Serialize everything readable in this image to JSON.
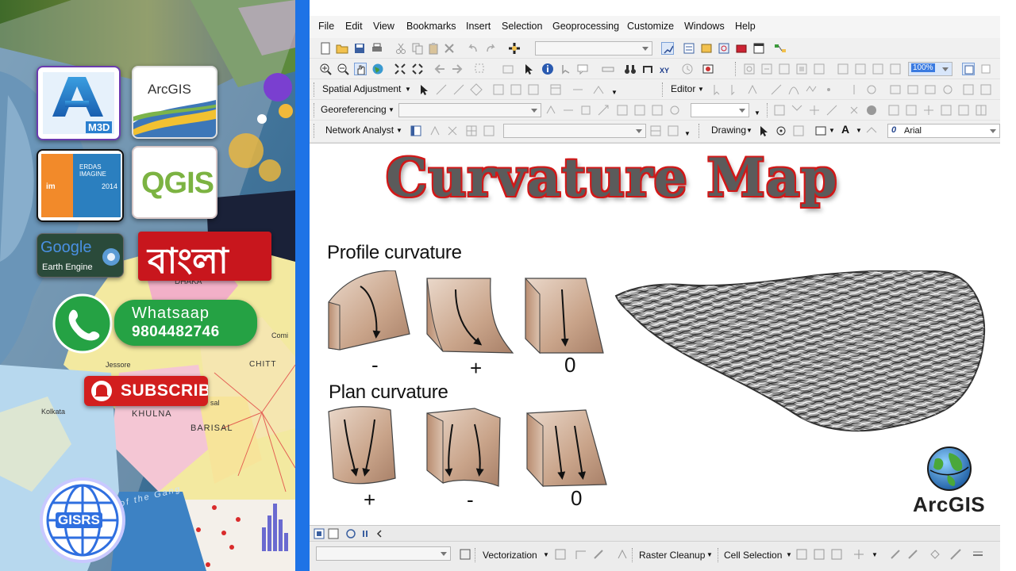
{
  "promo": {
    "autodesk_label": "M3D",
    "arcgis_badge": "ArcGIS",
    "erdas_title": "ERDAS IMAGINE",
    "erdas_year": "2014",
    "qgis_label": "QGIS",
    "google_ee_line1": "Google",
    "google_ee_line2": "Earth Engine",
    "bangla_label": "বাংলা",
    "whatsapp_name": "Whatsaap",
    "whatsapp_number": "9804482746",
    "subscribe_label": "SUBSCRIBE",
    "gisrs_label": "GISRS",
    "map_labels": {
      "dhaka": "DHAKA",
      "jessore": "Jessore",
      "kolkata": "Kolkata",
      "khulna": "KHULNA",
      "barisal": "BARISAL",
      "chitt": "CHITT",
      "comi": "Comi",
      "sal": "sal",
      "ganga": "of the Gang"
    }
  },
  "menubar": {
    "items": [
      "File",
      "Edit",
      "View",
      "Bookmarks",
      "Insert",
      "Selection",
      "Geoprocessing",
      "Customize",
      "Windows",
      "Help"
    ]
  },
  "toolbars": {
    "spatial_adjustment": "Spatial Adjustment",
    "editor": "Editor",
    "georeferencing": "Georeferencing",
    "network_analyst": "Network Analyst",
    "drawing": "Drawing",
    "font_name": "Arial",
    "zoom_value": "100%",
    "vectorization": "Vectorization",
    "raster_cleanup": "Raster Cleanup",
    "cell_selection": "Cell Selection"
  },
  "layout": {
    "title": "Curvature Map",
    "profile_heading": "Profile curvature",
    "plan_heading": "Plan curvature",
    "profile_signs": [
      "-",
      "+",
      "0"
    ],
    "plan_signs": [
      "+",
      "-",
      "0"
    ],
    "logo_text": "ArcGIS"
  },
  "colors": {
    "accent_blue": "#1e73e6",
    "title_outline": "#d11818",
    "title_fill": "#5b5b5b",
    "block_tan": "#c9a48a",
    "whatsapp_green": "#25a244",
    "subscribe_red": "#d21e1e"
  }
}
